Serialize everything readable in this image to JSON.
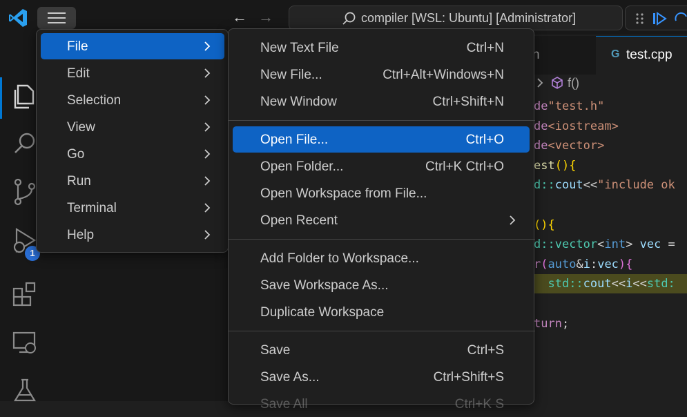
{
  "titlebar": {
    "command_center": "compiler [WSL: Ubuntu] [Administrator]",
    "back_label": "←",
    "forward_label": "→"
  },
  "activity_bar": {
    "icons": [
      "explorer-icon",
      "search-icon",
      "source-control-icon",
      "run-debug-icon",
      "extensions-icon",
      "remote-explorer-icon",
      "testing-icon"
    ],
    "debug_badge": "1"
  },
  "editor": {
    "tabs": [
      {
        "label": "h",
        "active": false
      },
      {
        "label": "test.cpp",
        "active": true,
        "icon_text": "G"
      }
    ],
    "breadcrumb": "f()",
    "code_lines": [
      [
        {
          "t": "de",
          "c": "#c586c0"
        },
        {
          "t": "\"test.h\"",
          "c": "#ce9178"
        }
      ],
      [
        {
          "t": "de",
          "c": "#c586c0"
        },
        {
          "t": "<iostream>",
          "c": "#ce9178"
        }
      ],
      [
        {
          "t": "de",
          "c": "#c586c0"
        },
        {
          "t": "<vector>",
          "c": "#ce9178"
        }
      ],
      [
        {
          "t": "est",
          "c": "#dcdcaa"
        },
        {
          "t": "(){",
          "c": "#ffd700"
        }
      ],
      [
        {
          "t": "d::",
          "c": "#4ec9b0"
        },
        {
          "t": "cout",
          "c": "#9cdcfe"
        },
        {
          "t": "<<",
          "c": "#d4d4d4"
        },
        {
          "t": "\"include ok",
          "c": "#ce9178"
        }
      ],
      [],
      [
        {
          "t": "(){",
          "c": "#ffd700"
        }
      ],
      [
        {
          "t": "d::",
          "c": "#4ec9b0"
        },
        {
          "t": "vector",
          "c": "#4ec9b0"
        },
        {
          "t": "<",
          "c": "#d4d4d4"
        },
        {
          "t": "int",
          "c": "#569cd6"
        },
        {
          "t": "> ",
          "c": "#d4d4d4"
        },
        {
          "t": "vec",
          "c": "#9cdcfe"
        },
        {
          "t": " =",
          "c": "#d4d4d4"
        }
      ],
      [
        {
          "t": "r",
          "c": "#c586c0"
        },
        {
          "t": "(",
          "c": "#da70d6"
        },
        {
          "t": "auto",
          "c": "#569cd6"
        },
        {
          "t": "&",
          "c": "#d4d4d4"
        },
        {
          "t": "i",
          "c": "#9cdcfe"
        },
        {
          "t": ":",
          "c": "#d4d4d4"
        },
        {
          "t": "vec",
          "c": "#9cdcfe"
        },
        {
          "t": "){",
          "c": "#da70d6"
        }
      ],
      [
        {
          "t": "  ",
          "c": "#d4d4d4"
        },
        {
          "t": "std::",
          "c": "#4ec9b0"
        },
        {
          "t": "cout",
          "c": "#9cdcfe"
        },
        {
          "t": "<<",
          "c": "#d4d4d4"
        },
        {
          "t": "i",
          "c": "#9cdcfe"
        },
        {
          "t": "<<",
          "c": "#d4d4d4"
        },
        {
          "t": "std:",
          "c": "#4ec9b0"
        }
      ],
      [],
      [
        {
          "t": "turn",
          "c": "#c586c0"
        },
        {
          "t": ";",
          "c": "#d4d4d4"
        }
      ]
    ],
    "highlight_line": 9
  },
  "main_menu": {
    "items": [
      {
        "label": "File",
        "selected": true
      },
      {
        "label": "Edit"
      },
      {
        "label": "Selection"
      },
      {
        "label": "View"
      },
      {
        "label": "Go"
      },
      {
        "label": "Run"
      },
      {
        "label": "Terminal"
      },
      {
        "label": "Help"
      }
    ]
  },
  "file_menu": {
    "items": [
      {
        "label": "New Text File",
        "shortcut": "Ctrl+N"
      },
      {
        "label": "New File...",
        "shortcut": "Ctrl+Alt+Windows+N"
      },
      {
        "label": "New Window",
        "shortcut": "Ctrl+Shift+N"
      },
      {
        "label": "Open File...",
        "shortcut": "Ctrl+O",
        "selected": true
      },
      {
        "label": "Open Folder...",
        "shortcut": "Ctrl+K Ctrl+O"
      },
      {
        "label": "Open Workspace from File...",
        "shortcut": ""
      },
      {
        "label": "Open Recent",
        "shortcut": "",
        "submenu": true
      },
      {
        "label": "Add Folder to Workspace...",
        "shortcut": ""
      },
      {
        "label": "Save Workspace As...",
        "shortcut": ""
      },
      {
        "label": "Duplicate Workspace",
        "shortcut": ""
      },
      {
        "label": "Save",
        "shortcut": "Ctrl+S"
      },
      {
        "label": "Save As...",
        "shortcut": "Ctrl+Shift+S"
      },
      {
        "label": "Save All",
        "shortcut": "Ctrl+K S"
      }
    ]
  },
  "colors": {
    "accent": "#0078d4",
    "selection": "#0e63c4",
    "menu_bg": "#1f1f1f",
    "titlebar_bg": "#181818"
  }
}
